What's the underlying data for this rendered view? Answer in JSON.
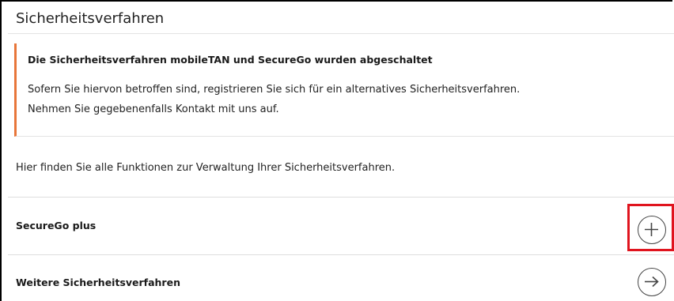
{
  "section": {
    "title": "Sicherheitsverfahren"
  },
  "notice": {
    "heading": "Die Sicherheitsverfahren mobileTAN und SecureGo wurden abgeschaltet",
    "line1": "Sofern Sie hiervon betroffen sind, registrieren Sie sich für ein alternatives Sicherheitsverfahren.",
    "line2": "Nehmen Sie gegebenenfalls Kontakt mit uns auf.",
    "accent_color": "#e8763a"
  },
  "intro_text": "Hier finden Sie alle Funktionen zur Verwaltung Ihrer Sicherheitsverfahren.",
  "rows": [
    {
      "label": "SecureGo plus",
      "action_icon": "plus-circle-icon"
    },
    {
      "label": "Weitere Sicherheitsverfahren",
      "action_icon": "arrow-right-circle-icon"
    }
  ],
  "highlight_color": "#e0141e"
}
